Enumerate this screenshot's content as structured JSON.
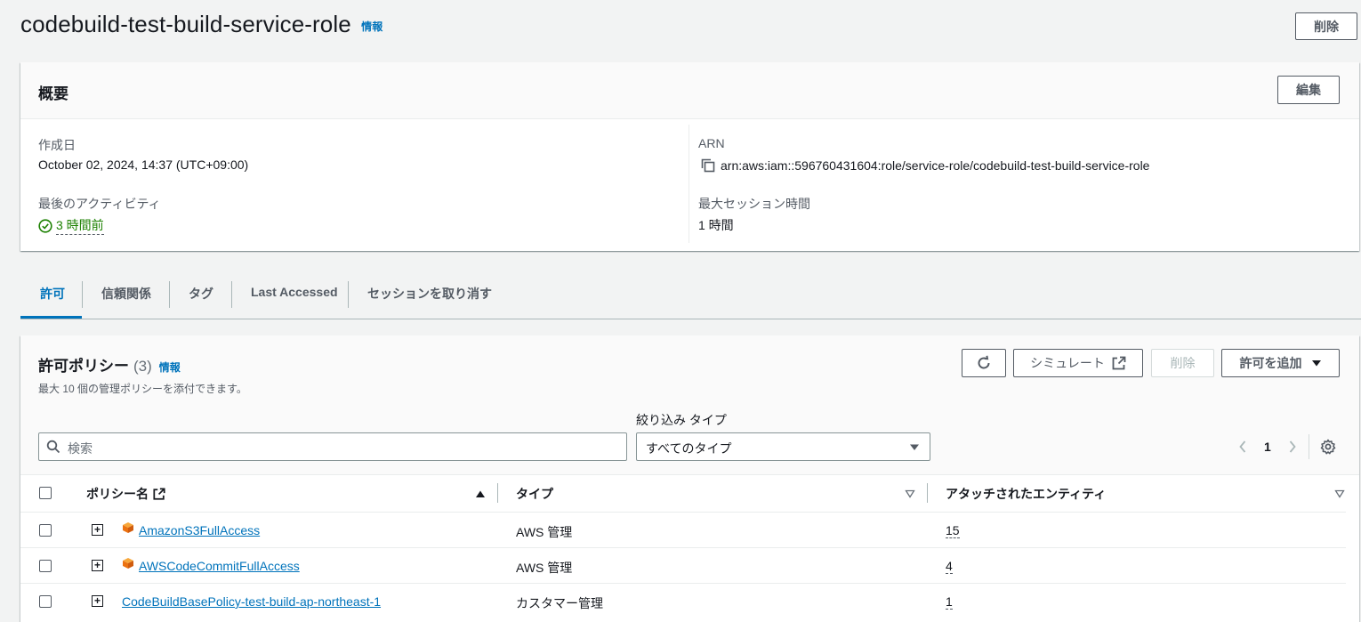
{
  "header": {
    "title": "codebuild-test-build-service-role",
    "info": "情報",
    "delete_label": "削除"
  },
  "summary": {
    "title": "概要",
    "edit_label": "編集",
    "created_label": "作成日",
    "created_value": "October 02, 2024, 14:37 (UTC+09:00)",
    "last_activity_label": "最後のアクティビティ",
    "last_activity_value": "3 時間前",
    "arn_label": "ARN",
    "arn_value": "arn:aws:iam::596760431604:role/service-role/codebuild-test-build-service-role",
    "max_session_label": "最大セッション時間",
    "max_session_value": "1 時間"
  },
  "tabs": [
    {
      "label": "許可"
    },
    {
      "label": "信頼関係"
    },
    {
      "label": "タグ"
    },
    {
      "label": "Last Accessed"
    },
    {
      "label": "セッションを取り消す"
    }
  ],
  "policies": {
    "title": "許可ポリシー",
    "count": "(3)",
    "info": "情報",
    "description": "最大 10 個の管理ポリシーを添付できます。",
    "simulate_label": "シミュレート",
    "delete_label": "削除",
    "add_label": "許可を追加",
    "filter_type_label": "絞り込み タイプ",
    "search_placeholder": "検索",
    "type_selected": "すべてのタイプ",
    "page_number": "1",
    "columns": {
      "name": "ポリシー名",
      "type": "タイプ",
      "entities": "アタッチされたエンティティ"
    },
    "rows": [
      {
        "name": "AmazonS3FullAccess",
        "type": "AWS 管理",
        "entities": "15"
      },
      {
        "name": "AWSCodeCommitFullAccess",
        "type": "AWS 管理",
        "entities": "4"
      },
      {
        "name": "CodeBuildBasePolicy-test-build-ap-northeast-1",
        "type": "カスタマー管理",
        "entities": "1"
      }
    ]
  },
  "colors": {
    "link": "#0073bb",
    "success": "#1d8102",
    "aws_orange": "#ec7211"
  }
}
